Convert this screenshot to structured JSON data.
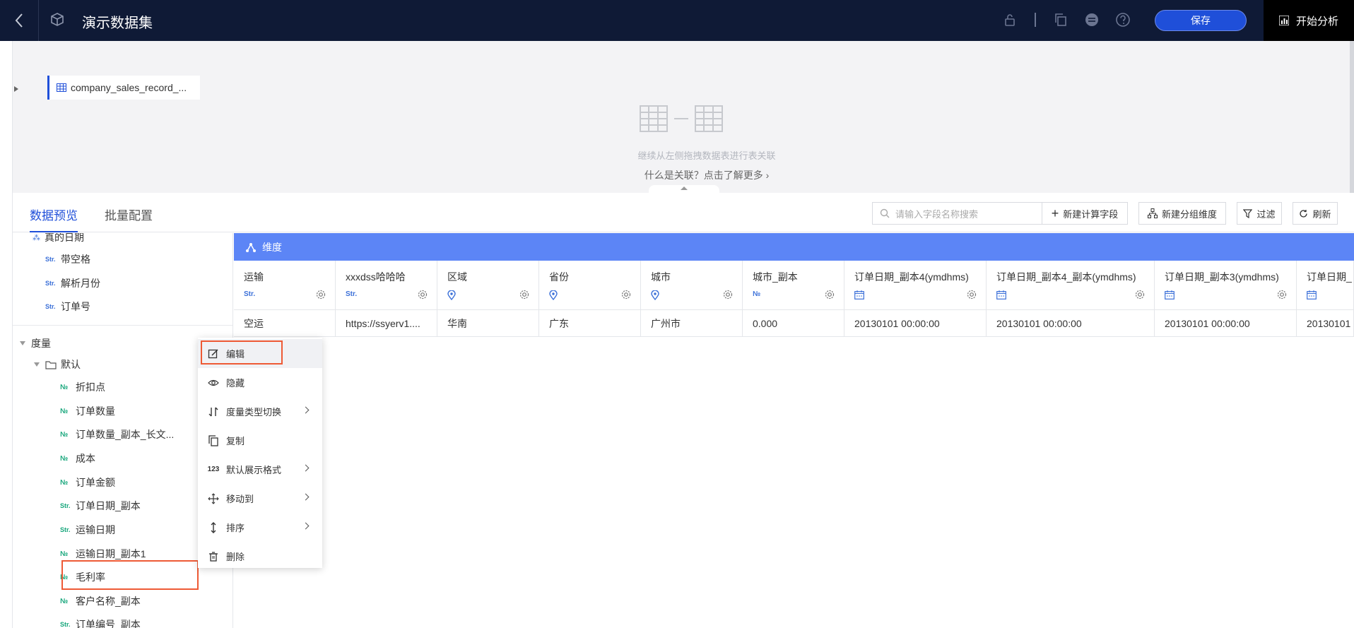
{
  "header": {
    "title": "演示数据集",
    "save_label": "保存",
    "analyze_label": "开始分析"
  },
  "canvas": {
    "table_name": "company_sales_record_...",
    "hint": "继续从左侧拖拽数据表进行表关联",
    "link": "什么是关联？点击了解更多"
  },
  "tabs": {
    "preview": "数据预览",
    "batch": "批量配置"
  },
  "toolbar": {
    "search_placeholder": "请输入字段名称搜索",
    "new_calc": "新建计算字段",
    "new_group": "新建分组维度",
    "filter": "过滤",
    "refresh": "刷新"
  },
  "fields": {
    "top_partial": "真的日期",
    "dims": [
      {
        "type": "Str.",
        "name": "带空格"
      },
      {
        "type": "Str.",
        "name": "解析月份"
      },
      {
        "type": "Str.",
        "name": "订单号"
      }
    ],
    "measure_section": "度量",
    "folder": "默认",
    "measures": [
      {
        "type": "№",
        "name": "折扣点"
      },
      {
        "type": "№",
        "name": "订单数量"
      },
      {
        "type": "№",
        "name": "订单数量_副本_长文..."
      },
      {
        "type": "№",
        "name": "成本"
      },
      {
        "type": "№",
        "name": "订单金额"
      },
      {
        "type": "Str.",
        "name": "订单日期_副本"
      },
      {
        "type": "Str.",
        "name": "运输日期"
      },
      {
        "type": "№",
        "name": "运输日期_副本1"
      },
      {
        "type": "№",
        "name": "毛利率"
      },
      {
        "type": "№",
        "name": "客户名称_副本"
      },
      {
        "type": "Str.",
        "name": "订单编号_副本"
      }
    ]
  },
  "grid": {
    "group_label": "维度",
    "columns": [
      {
        "name": "运输",
        "type": "Str."
      },
      {
        "name": "xxxdss哈哈哈",
        "type": "Str."
      },
      {
        "name": "区域",
        "type": "geo"
      },
      {
        "name": "省份",
        "type": "geo"
      },
      {
        "name": "城市",
        "type": "geo"
      },
      {
        "name": "城市_副本",
        "type": "№"
      },
      {
        "name": "订单日期_副本4(ymdhms)",
        "type": "date"
      },
      {
        "name": "订单日期_副本4_副本(ymdhms)",
        "type": "date"
      },
      {
        "name": "订单日期_副本3(ymdhms)",
        "type": "date"
      },
      {
        "name": "订单日期_",
        "type": "date"
      }
    ],
    "row": [
      "空运",
      "https://ssyerv1....",
      "华南",
      "广东",
      "广州市",
      "0.000",
      "20130101 00:00:00",
      "20130101 00:00:00",
      "20130101 00:00:00",
      "20130101"
    ]
  },
  "context_menu": {
    "edit": "编辑",
    "hide": "隐藏",
    "switch_type": "度量类型切换",
    "copy": "复制",
    "format": "默认展示格式",
    "move_to": "移动到",
    "sort": "排序",
    "delete": "删除",
    "format_icon_text": "123"
  },
  "colors": {
    "topbar": "#0f1a36",
    "accent": "#1f4fd9",
    "dim_bar": "#5c85f6",
    "highlight": "#ee5a35"
  }
}
